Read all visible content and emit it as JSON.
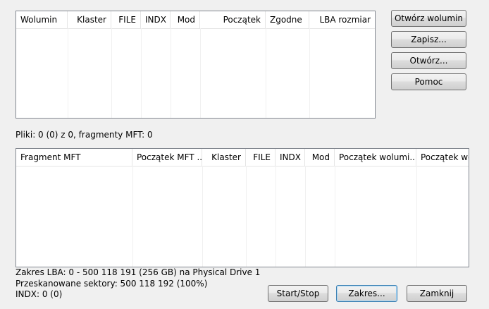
{
  "volumes_table": {
    "columns": [
      "Wolumin",
      "Klaster",
      "FILE",
      "INDX",
      "Mod",
      "Początek",
      "Zgodne",
      "LBA rozmiar"
    ],
    "rows": []
  },
  "buttons": {
    "open_volume": "Otwórz wolumin",
    "save": "Zapisz...",
    "open": "Otwórz...",
    "help": "Pomoc",
    "start_stop": "Start/Stop",
    "range": "Zakres...",
    "close": "Zamknij"
  },
  "files_status": "Pliki: 0 (0) z 0, fragmenty MFT: 0",
  "fragments_table": {
    "columns": [
      "Fragment MFT",
      "Początek MFT ...",
      "Klaster",
      "FILE",
      "INDX",
      "Mod",
      "Początek wolumi...",
      "Początek wo"
    ],
    "rows": []
  },
  "status": {
    "lba_range": "Zakres LBA: 0 - 500 118 191 (256 GB) na Physical Drive 1",
    "scanned_sectors": "Przeskanowane sektory: 500 118 192 (100%)",
    "indx": "INDX: 0 (0)"
  }
}
